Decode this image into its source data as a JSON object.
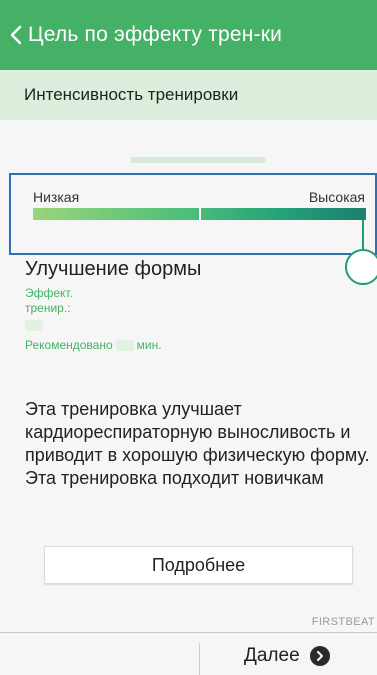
{
  "header": {
    "title": "Цель по эффекту трен-ки",
    "back_icon": "chevron-left-icon",
    "color": "#45b167"
  },
  "section": {
    "title": "Интенсивность тренировки"
  },
  "slider": {
    "low_label": "Низкая",
    "high_label": "Высокая",
    "level": 1.0,
    "colors": [
      "#9bd47a",
      "#4fbf7a",
      "#24a17a",
      "#1c7f70"
    ],
    "highlight_border": "#2e6fb5"
  },
  "detail": {
    "heading": "Улучшение формы",
    "effect_label_line1": "Эффект.",
    "effect_label_line2": "тренир.:",
    "recommended_prefix": "Рекомендовано",
    "recommended_suffix": "мин.",
    "description": "Эта тренировка улучшает кардиореспираторную выносливость и приводит в хорошую физическую форму. Эта тренировка подходит новичкам"
  },
  "actions": {
    "more_label": "Подробнее",
    "next_label": "Далее",
    "next_icon": "chevron-right-circle-icon"
  },
  "footer": {
    "brand": "FIRSTBEAT"
  }
}
